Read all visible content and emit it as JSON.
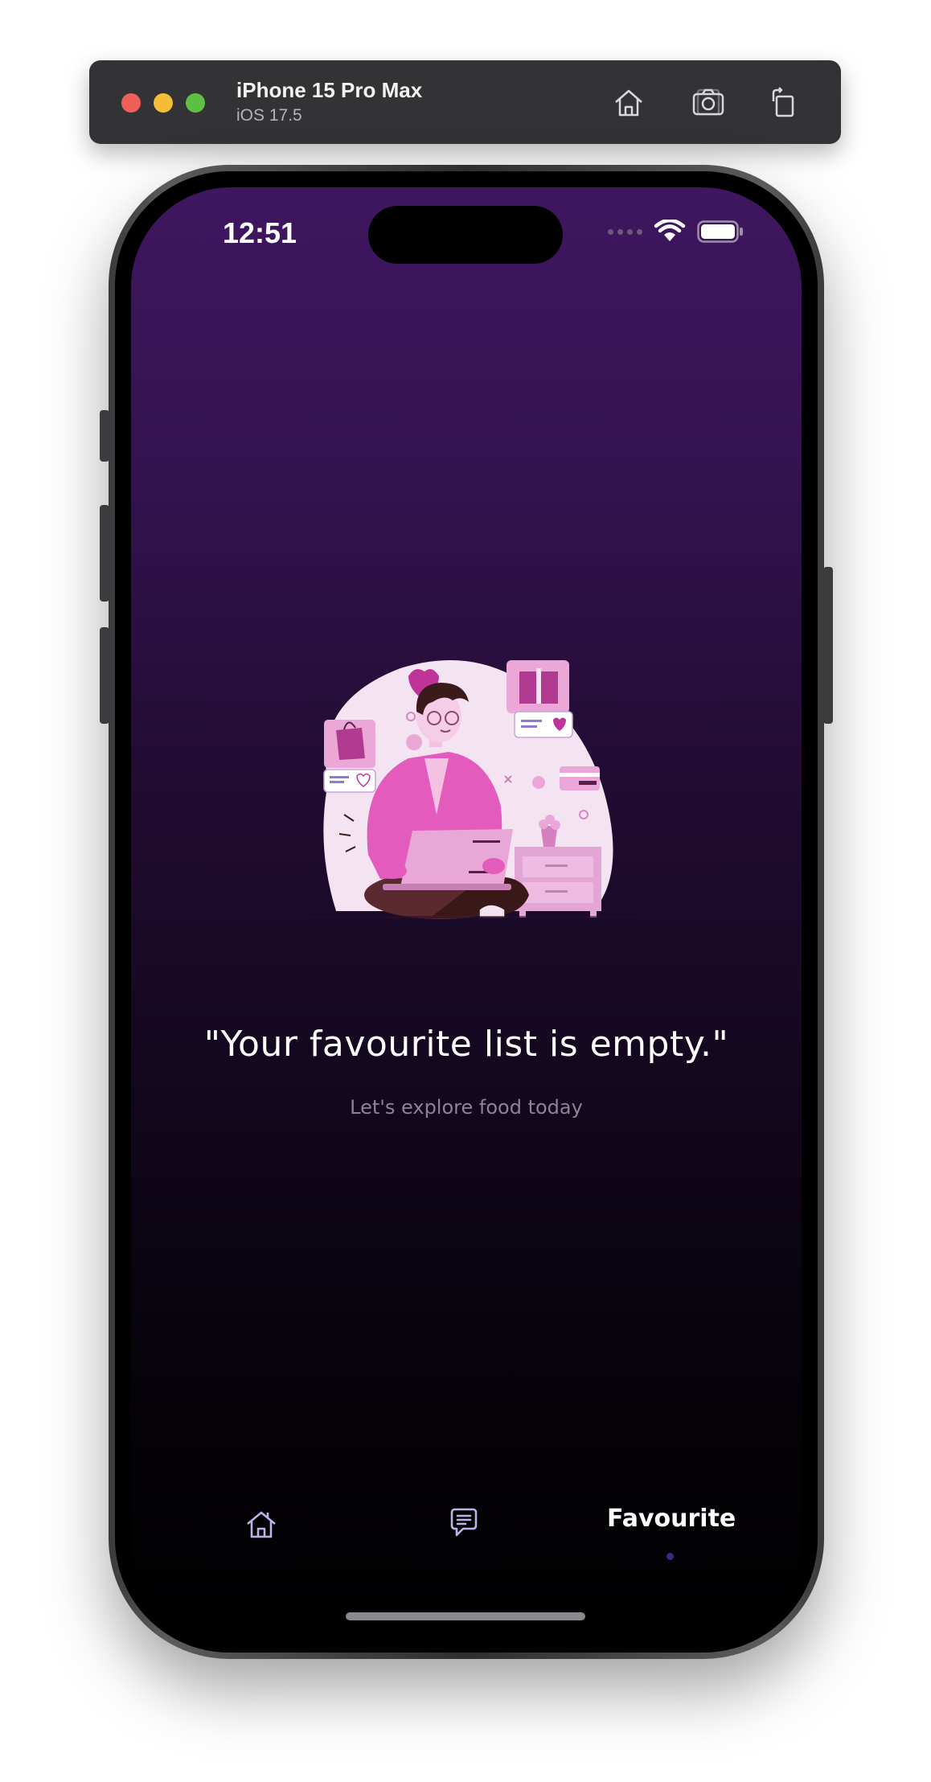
{
  "simulator": {
    "device_name": "iPhone 15 Pro Max",
    "os_version": "iOS 17.5",
    "buttons": [
      "home-icon",
      "screenshot-icon",
      "rotate-icon"
    ]
  },
  "status_bar": {
    "time": "12:51",
    "icons": [
      "cellular-dots-icon",
      "wifi-icon",
      "battery-icon"
    ]
  },
  "empty_state": {
    "title": "\"Your favourite list is empty.\"",
    "subtitle": "Let's explore food today",
    "illustration": "person-shopping-online-illustration"
  },
  "tabbar": {
    "tabs": [
      {
        "icon": "home-icon",
        "label": ""
      },
      {
        "icon": "chat-icon",
        "label": ""
      },
      {
        "icon": "",
        "label": "Favourite"
      }
    ],
    "active_tab": "Favourite"
  },
  "colors": {
    "background_top": "#3f1660",
    "background_bottom": "#000000",
    "accent_pink": "#e05bbf",
    "tab_icon": "#b9b3e6",
    "active_dot": "#2e2f8a"
  }
}
